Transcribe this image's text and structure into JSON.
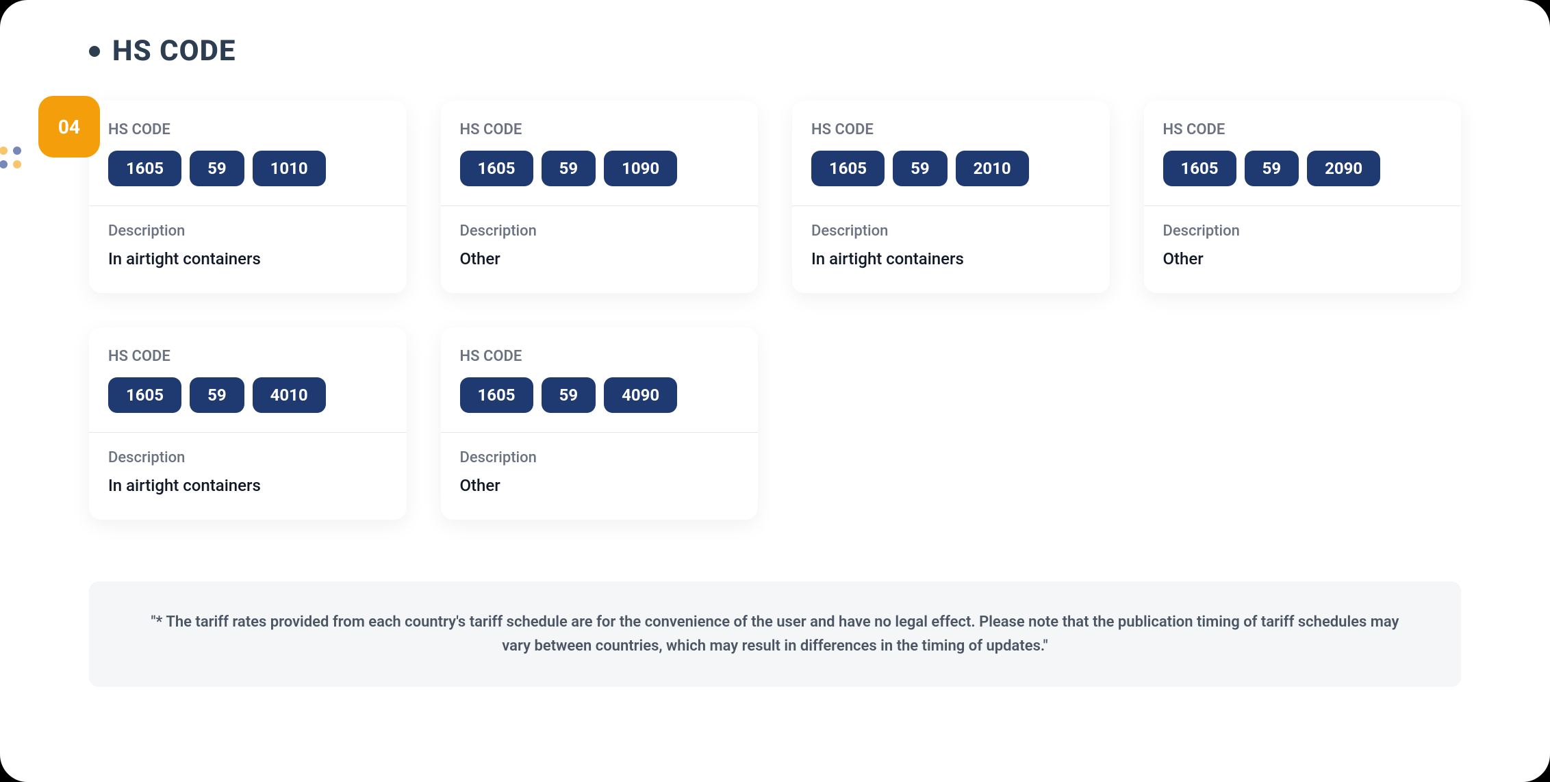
{
  "section_title": "HS CODE",
  "badge_number": "04",
  "card_label": "HS CODE",
  "desc_label": "Description",
  "cards": [
    {
      "codes": [
        "1605",
        "59",
        "1010"
      ],
      "description": "In airtight containers"
    },
    {
      "codes": [
        "1605",
        "59",
        "1090"
      ],
      "description": "Other"
    },
    {
      "codes": [
        "1605",
        "59",
        "2010"
      ],
      "description": "In airtight containers"
    },
    {
      "codes": [
        "1605",
        "59",
        "2090"
      ],
      "description": "Other"
    },
    {
      "codes": [
        "1605",
        "59",
        "4010"
      ],
      "description": "In airtight containers"
    },
    {
      "codes": [
        "1605",
        "59",
        "4090"
      ],
      "description": "Other"
    }
  ],
  "disclaimer": "\"* The tariff rates provided from each country's tariff schedule are for the convenience of the user and have no legal effect. Please note that the publication timing of tariff schedules may vary between countries, which may result in differences in the timing of updates.\""
}
